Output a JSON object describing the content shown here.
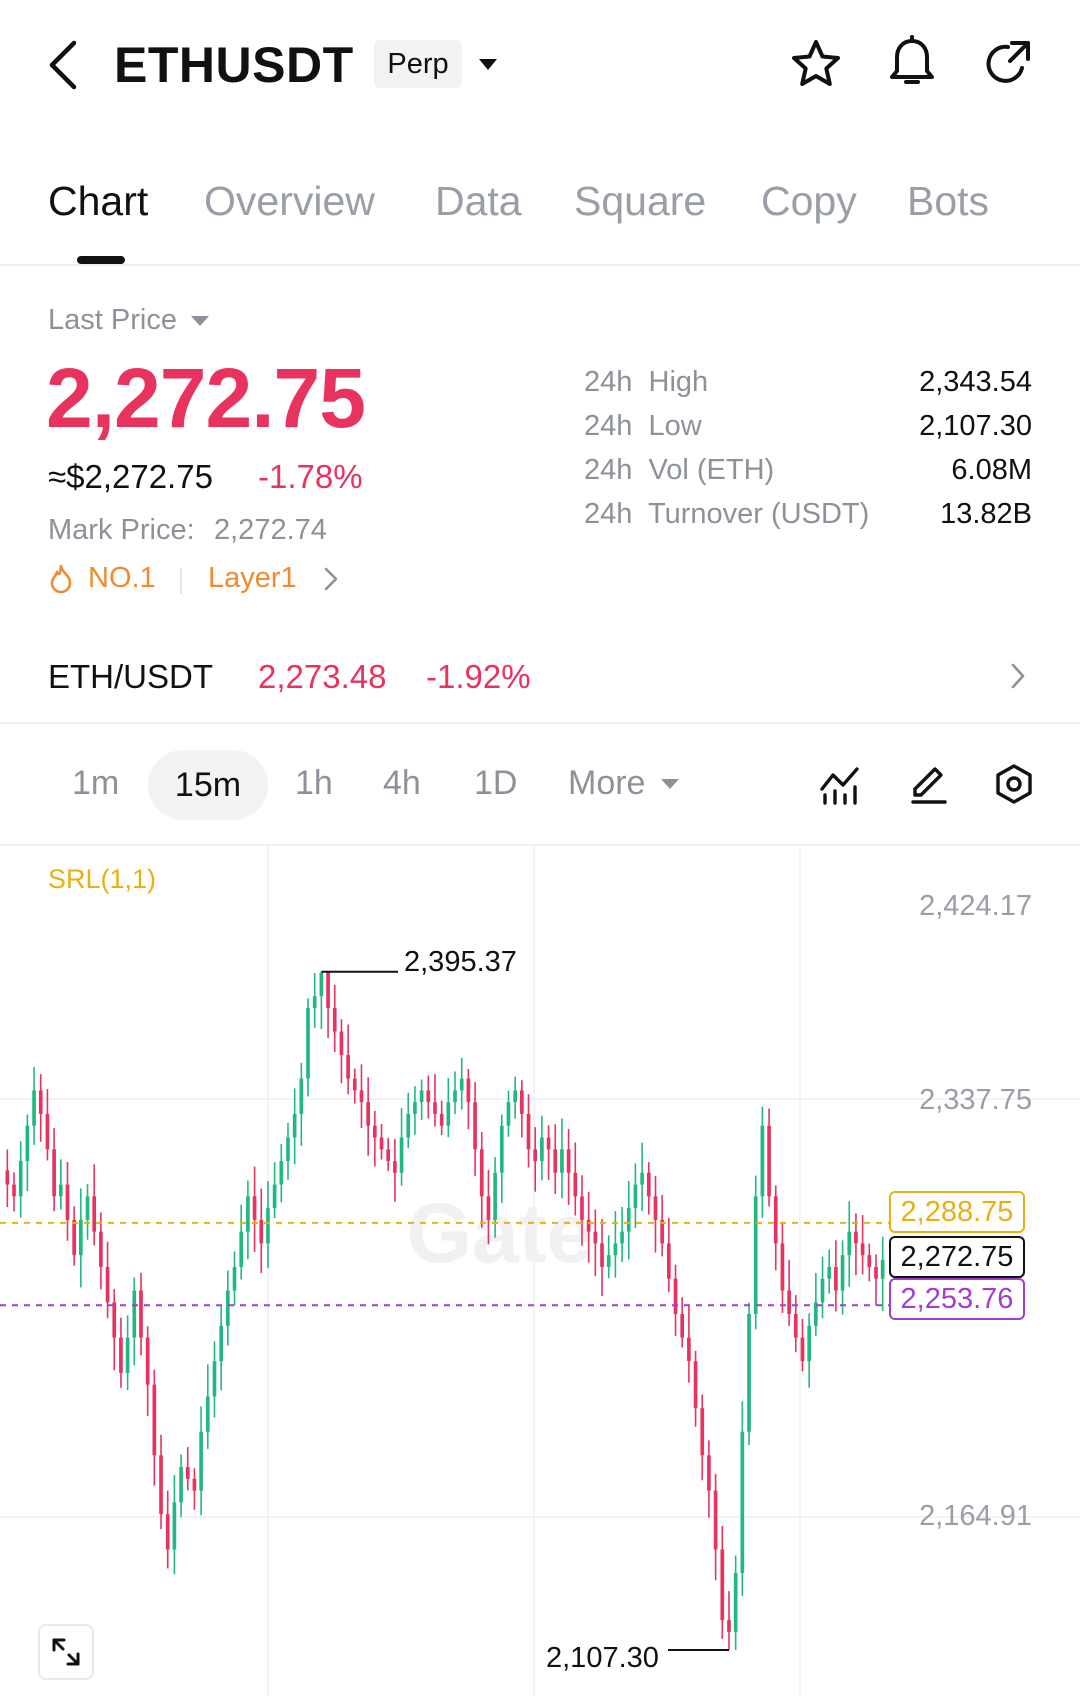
{
  "header": {
    "symbol": "ETHUSDT",
    "contract_type": "Perp",
    "icons": [
      "back-icon",
      "dropdown-caret-icon",
      "star-icon",
      "bell-icon",
      "share-icon"
    ]
  },
  "tabs": [
    {
      "label": "Chart",
      "active": true
    },
    {
      "label": "Overview",
      "active": false
    },
    {
      "label": "Data",
      "active": false
    },
    {
      "label": "Square",
      "active": false
    },
    {
      "label": "Copy",
      "active": false
    },
    {
      "label": "Bots",
      "active": false
    }
  ],
  "price": {
    "label": "Last Price",
    "last": "2,272.75",
    "usd_approx": "≈$2,272.75",
    "change": "-1.78%",
    "mark_label": "Mark Price:",
    "mark_value": "2,272.74",
    "rank": "NO.1",
    "category": "Layer1"
  },
  "stats": [
    {
      "label": "24h  High",
      "value": "2,343.54"
    },
    {
      "label": "24h  Low",
      "value": "2,107.30"
    },
    {
      "label": "24h  Vol (ETH)",
      "value": "6.08M"
    },
    {
      "label": "24h  Turnover (USDT)",
      "value": "13.82B"
    }
  ],
  "spot": {
    "pair": "ETH/USDT",
    "price": "2,273.48",
    "change": "-1.92%"
  },
  "timeframes": {
    "items": [
      "1m",
      "15m",
      "1h",
      "4h",
      "1D"
    ],
    "selected": "15m",
    "more": "More"
  },
  "chart": {
    "indicator": "SRL(1,1)",
    "axis_labels": [
      "2,424.17",
      "2,337.75",
      "2,164.91"
    ],
    "high_marker": "2,395.37",
    "low_marker": "2,107.30",
    "lines": {
      "upper": "2,288.75",
      "current": "2,272.75",
      "lower": "2,253.76"
    },
    "watermark": "Gate"
  },
  "colors": {
    "up": "#22b981",
    "down": "#e8335f",
    "accent_orange": "#f08b2f",
    "srl_yellow": "#e8b012",
    "srl_purple": "#a43cd0"
  },
  "chart_data": {
    "type": "candlestick",
    "interval": "15m",
    "ylim": [
      2107.3,
      2424.17
    ],
    "high": 2395.37,
    "low": 2107.3,
    "last": 2272.75,
    "reference_lines": [
      2288.75,
      2272.75,
      2253.76
    ],
    "close_series": [
      2305,
      2300,
      2315,
      2330,
      2345,
      2335,
      2320,
      2300,
      2305,
      2290,
      2275,
      2290,
      2300,
      2285,
      2270,
      2255,
      2240,
      2225,
      2240,
      2260,
      2240,
      2220,
      2190,
      2165,
      2150,
      2170,
      2185,
      2180,
      2175,
      2200,
      2215,
      2230,
      2245,
      2260,
      2270,
      2285,
      2300,
      2290,
      2280,
      2295,
      2305,
      2315,
      2325,
      2335,
      2350,
      2380,
      2385,
      2395,
      2380,
      2370,
      2360,
      2350,
      2345,
      2340,
      2330,
      2325,
      2320,
      2315,
      2310,
      2325,
      2335,
      2340,
      2345,
      2340,
      2335,
      2330,
      2340,
      2345,
      2350,
      2340,
      2320,
      2300,
      2290,
      2310,
      2330,
      2340,
      2345,
      2335,
      2320,
      2315,
      2325,
      2320,
      2310,
      2320,
      2310,
      2300,
      2290,
      2285,
      2280,
      2270,
      2275,
      2280,
      2285,
      2295,
      2305,
      2310,
      2300,
      2290,
      2280,
      2265,
      2250,
      2240,
      2230,
      2210,
      2190,
      2175,
      2150,
      2120,
      2115,
      2140,
      2200,
      2250,
      2300,
      2330,
      2300,
      2280,
      2260,
      2250,
      2240,
      2230,
      2245,
      2255,
      2265,
      2270,
      2260,
      2275,
      2285,
      2280,
      2275,
      2270,
      2265,
      2273
    ]
  }
}
